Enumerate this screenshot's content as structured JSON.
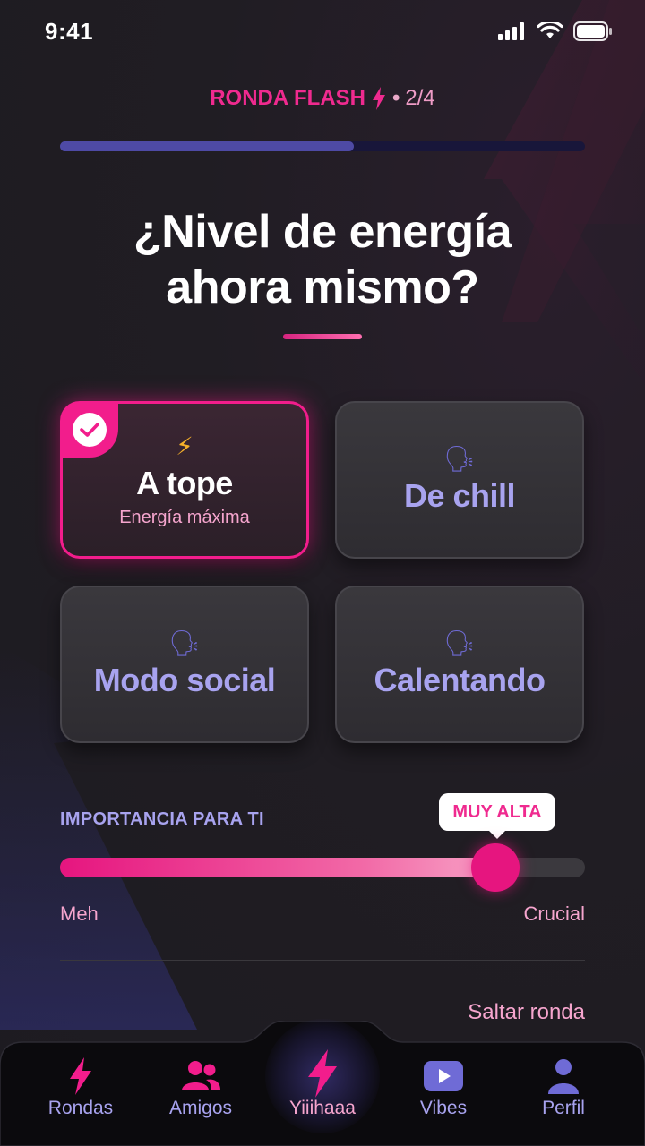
{
  "status_bar": {
    "time": "9:41"
  },
  "header": {
    "round_name": "RONDA FLASH",
    "separator": "•",
    "round_count": "2/4",
    "progress": 0.56
  },
  "question": {
    "line1": "¿Nivel de energía",
    "line2": "ahora mismo?"
  },
  "options": [
    {
      "emoji": "⚡",
      "title": "A tope",
      "subtitle": "Energía máxima",
      "selected": true
    },
    {
      "emoji": "🗣",
      "title": "De chill",
      "selected": false
    },
    {
      "emoji": "🗣",
      "title": "Modo social",
      "selected": false
    },
    {
      "emoji": "🗣",
      "title": "Calentando",
      "selected": false
    }
  ],
  "importance": {
    "label": "IMPORTANCIA PARA TI",
    "tooltip": "MUY ALTA",
    "value": 0.83,
    "min_label": "Meh",
    "max_label": "Crucial"
  },
  "skip_label": "Saltar ronda",
  "tabbar": {
    "items": [
      {
        "label": "Rondas",
        "icon": "lightning-icon"
      },
      {
        "label": "Amigos",
        "icon": "friends-icon"
      },
      {
        "label": "Yiiihaaa",
        "icon": "lightning-icon",
        "active": true
      },
      {
        "label": "Vibes",
        "icon": "video-icon"
      },
      {
        "label": "Perfil",
        "icon": "person-icon"
      }
    ]
  },
  "colors": {
    "accent": "#f21d8c",
    "lavender": "#a8a3ef",
    "background": "#1f1d22"
  }
}
